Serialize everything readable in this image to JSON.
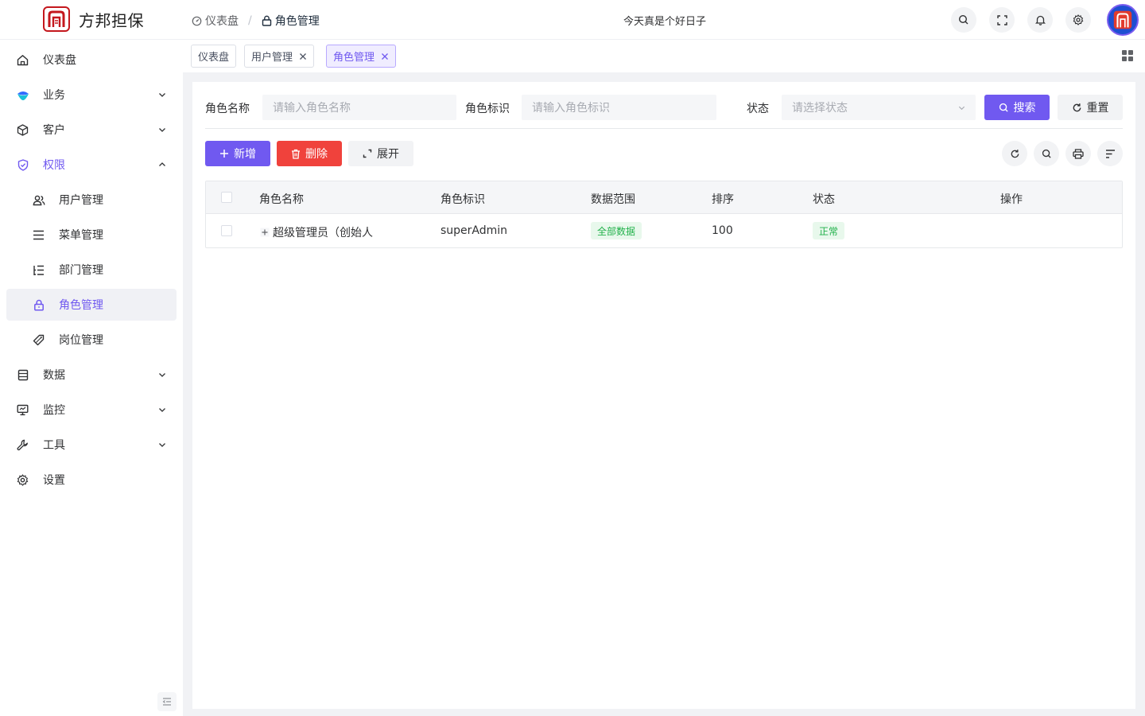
{
  "brand": {
    "name": "方邦担保",
    "logo_color": "#c4171d"
  },
  "breadcrumb": [
    {
      "label": "仪表盘",
      "icon": "dashboard-icon"
    },
    {
      "label": "角色管理",
      "icon": "lock-icon"
    }
  ],
  "header": {
    "motto": "今天真是个好日子",
    "actions": [
      "search-icon",
      "fullscreen-icon",
      "bell-icon",
      "gear-icon"
    ]
  },
  "tabs": [
    {
      "label": "仪表盘",
      "closable": false,
      "active": false
    },
    {
      "label": "用户管理",
      "closable": true,
      "active": false
    },
    {
      "label": "角色管理",
      "closable": true,
      "active": true
    }
  ],
  "sidebar": {
    "items": [
      {
        "label": "仪表盘",
        "icon": "home-icon"
      },
      {
        "label": "业务",
        "icon": "business-icon",
        "expandable": true
      },
      {
        "label": "客户",
        "icon": "cube-icon",
        "expandable": true
      },
      {
        "label": "权限",
        "icon": "shield-icon",
        "expandable": true,
        "open": true
      },
      {
        "label": "用户管理",
        "icon": "users-icon",
        "sub": true
      },
      {
        "label": "菜单管理",
        "icon": "menu-icon",
        "sub": true
      },
      {
        "label": "部门管理",
        "icon": "list-tree-icon",
        "sub": true
      },
      {
        "label": "角色管理",
        "icon": "lock-icon",
        "sub": true,
        "selected": true
      },
      {
        "label": "岗位管理",
        "icon": "tag-icon",
        "sub": true
      },
      {
        "label": "数据",
        "icon": "database-icon",
        "expandable": true
      },
      {
        "label": "监控",
        "icon": "monitor-icon",
        "expandable": true
      },
      {
        "label": "工具",
        "icon": "wrench-icon",
        "expandable": true
      },
      {
        "label": "设置",
        "icon": "gear-icon"
      }
    ]
  },
  "search_form": {
    "role_name": {
      "label": "角色名称",
      "placeholder": "请输入角色名称"
    },
    "role_key": {
      "label": "角色标识",
      "placeholder": "请输入角色标识"
    },
    "status": {
      "label": "状态",
      "placeholder": "请选择状态"
    },
    "search_label": "搜索",
    "reset_label": "重置"
  },
  "toolbar": {
    "add_label": "新增",
    "delete_label": "删除",
    "expand_label": "展开",
    "right_actions": [
      "refresh-icon",
      "search-icon",
      "print-icon",
      "sort-icon"
    ]
  },
  "table": {
    "columns": [
      "角色名称",
      "角色标识",
      "数据范围",
      "排序",
      "状态",
      "操作"
    ],
    "rows": [
      {
        "name": "超级管理员（创始人",
        "key": "superAdmin",
        "scope": "全部数据",
        "sort": "100",
        "status": "正常"
      }
    ]
  },
  "colors": {
    "primary": "#7059f0",
    "danger": "#f0423c",
    "success": "#21b14a"
  }
}
